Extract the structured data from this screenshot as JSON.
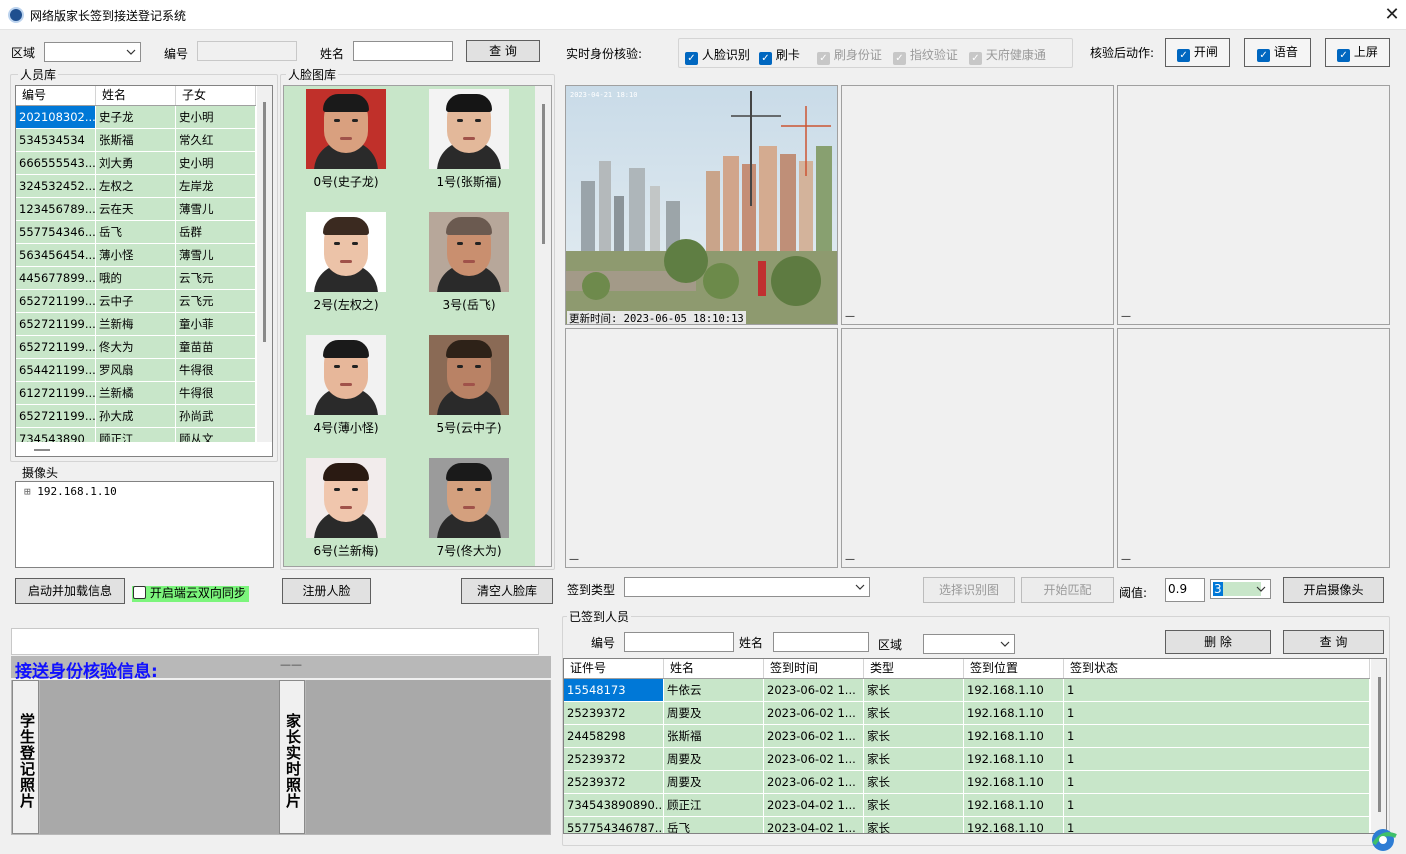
{
  "window": {
    "title": "网络版家长签到接送登记系统",
    "close": "✕"
  },
  "search": {
    "area_label": "区域",
    "area_value": "",
    "id_label": "编号",
    "id_value": "",
    "name_label": "姓名",
    "name_value": "",
    "query": "查 询"
  },
  "realtime": {
    "label": "实时身份核验:",
    "checks": [
      {
        "label": "人脸识别",
        "checked": true,
        "enabled": true
      },
      {
        "label": "刷卡",
        "checked": true,
        "enabled": true
      },
      {
        "label": "刷身份证",
        "checked": true,
        "enabled": false
      },
      {
        "label": "指纹验证",
        "checked": true,
        "enabled": false
      },
      {
        "label": "天府健康通",
        "checked": true,
        "enabled": false
      }
    ]
  },
  "actions": {
    "label": "核验后动作:",
    "items": [
      "开闸",
      "语音",
      "上屏"
    ]
  },
  "person_lib": {
    "title": "人员库",
    "headers": [
      "编号",
      "姓名",
      "子女"
    ],
    "rows": [
      [
        "202108302...",
        "史子龙",
        "史小明"
      ],
      [
        "534534534",
        "张斯福",
        "常久红"
      ],
      [
        "666555543...",
        "刘大勇",
        "史小明"
      ],
      [
        "324532452...",
        "左权之",
        "左岸龙"
      ],
      [
        "123456789...",
        "云在天",
        "薄雪儿"
      ],
      [
        "557754346...",
        "岳飞",
        "岳群"
      ],
      [
        "563456454...",
        "薄小怪",
        "薄雪儿"
      ],
      [
        "445677899...",
        "哦的",
        "云飞元"
      ],
      [
        "652721199...",
        "云中子",
        "云飞元"
      ],
      [
        "652721199...",
        "兰新梅",
        "童小菲"
      ],
      [
        "652721199...",
        "佟大为",
        "童苗苗"
      ],
      [
        "654421199...",
        "罗风扇",
        "牛得很"
      ],
      [
        "612721199...",
        "兰新橘",
        "牛得很"
      ],
      [
        "652721199...",
        "孙大成",
        "孙尚武"
      ],
      [
        "734543890",
        "顾正江",
        "顾从文"
      ]
    ]
  },
  "camera_tree": {
    "title": "摄像头",
    "expander": "⊞",
    "node": "192.168.1.10"
  },
  "face_lib": {
    "title": "人脸图库",
    "faces": [
      "0号(史子龙)",
      "1号(张斯福)",
      "2号(左权之)",
      "3号(岳飞)",
      "4号(薄小怪)",
      "5号(云中子)",
      "6号(兰新梅)",
      "7号(佟大为)"
    ]
  },
  "left_buttons": {
    "load": "启动并加载信息",
    "cloud_sync": "开启端云双向同步",
    "register": "注册人脸",
    "clear": "清空人脸库"
  },
  "verify": {
    "title": "接送身份核验信息:",
    "mark": "——",
    "student_photo": "学生登记照片",
    "parent_photo": "家长实时照片"
  },
  "cameras": {
    "stamp": "2023-04-21 18:10",
    "update_time": "更新时间: 2023-06-05 18:10:13",
    "dash": "—"
  },
  "checkin_ctrl": {
    "type_label": "签到类型",
    "type_value": "",
    "select_img": "选择识别图",
    "match": "开始匹配",
    "threshold_label": "阈值:",
    "threshold_value": "0.9",
    "combo_value": "3",
    "open_cam": "开启摄像头"
  },
  "signed": {
    "title": "已签到人员",
    "id_label": "编号",
    "name_label": "姓名",
    "area_label": "区域",
    "delete": "删 除",
    "query": "查 询",
    "headers": [
      "证件号",
      "姓名",
      "签到时间",
      "类型",
      "签到位置",
      "签到状态"
    ],
    "rows": [
      [
        "15548173",
        "牛依云",
        "2023-06-02 1...",
        "家长",
        "192.168.1.10",
        "1"
      ],
      [
        "25239372",
        "周要及",
        "2023-06-02 1...",
        "家长",
        "192.168.1.10",
        "1"
      ],
      [
        "24458298",
        "张斯福",
        "2023-06-02 1...",
        "家长",
        "192.168.1.10",
        "1"
      ],
      [
        "25239372",
        "周要及",
        "2023-06-02 1...",
        "家长",
        "192.168.1.10",
        "1"
      ],
      [
        "25239372",
        "周要及",
        "2023-06-02 1...",
        "家长",
        "192.168.1.10",
        "1"
      ],
      [
        "734543890890...",
        "顾正江",
        "2023-04-02 1...",
        "家长",
        "192.168.1.10",
        "1"
      ],
      [
        "557754346787...",
        "岳飞",
        "2023-04-02 1...",
        "家长",
        "192.168.1.10",
        "1"
      ]
    ]
  },
  "colors": {
    "grid_row": "#c8e6c9",
    "selected": "#0078d7",
    "verify_title": "#1010ff",
    "check": "#0067c0"
  }
}
